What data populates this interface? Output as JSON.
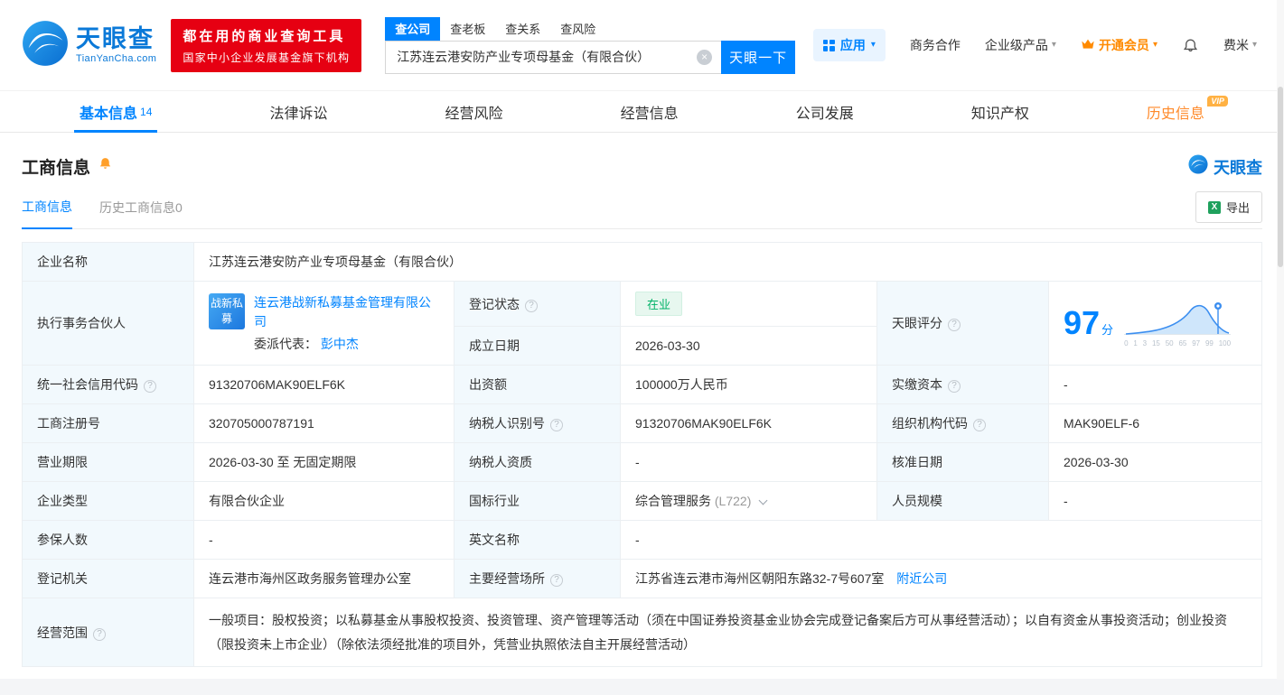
{
  "colors": {
    "brand_blue": "#0084ff",
    "banner_red": "#e60012",
    "vip_orange": "#ff8a00",
    "status_green": "#00b267"
  },
  "icons": {
    "clear": "×",
    "caret_down": "▾",
    "help": "?",
    "excel": "X"
  },
  "header": {
    "brand": {
      "name": "天眼查",
      "domain": "TianYanCha.com"
    },
    "slogan": {
      "line1": "都在用的商业查询工具",
      "line2": "国家中小企业发展基金旗下机构"
    },
    "search": {
      "tabs": [
        {
          "label": "查公司"
        },
        {
          "label": "查老板"
        },
        {
          "label": "查关系"
        },
        {
          "label": "查风险"
        }
      ],
      "value": "江苏连云港安防产业专项母基金（有限合伙）",
      "button": "天眼一下"
    },
    "menu": {
      "apps": "应用",
      "cooperation": "商务合作",
      "enterprise": "企业级产品",
      "vip": "开通会员",
      "user": "费米"
    }
  },
  "nav": {
    "vip_badge": "VIP",
    "tabs": [
      {
        "label": "基本信息",
        "count": "14"
      },
      {
        "label": "法律诉讼"
      },
      {
        "label": "经营风险"
      },
      {
        "label": "经营信息"
      },
      {
        "label": "公司发展"
      },
      {
        "label": "知识产权"
      },
      {
        "label": "历史信息"
      }
    ]
  },
  "section": {
    "title": "工商信息",
    "brand": "天眼查",
    "subtab_active": "工商信息",
    "subtab_history": "历史工商信息0",
    "export": "导出"
  },
  "biz": {
    "company_name": {
      "label": "企业名称",
      "value": "江苏连云港安防产业专项母基金（有限合伙）"
    },
    "partner": {
      "label": "执行事务合伙人",
      "badge": "战新私募",
      "company": "连云港战新私募基金管理有限公司",
      "delegate_label": "委派代表：",
      "delegate": "彭中杰"
    },
    "reg_status": {
      "label": "登记状态",
      "value": "在业"
    },
    "establish_date": {
      "label": "成立日期",
      "value": "2026-03-30"
    },
    "score": {
      "label": "天眼评分",
      "value": "97",
      "unit": "分",
      "ticks": [
        "0",
        "1",
        "3",
        "15",
        "50",
        "65",
        "97",
        "99",
        "100"
      ]
    },
    "credit_code": {
      "label": "统一社会信用代码",
      "value": "91320706MAK90ELF6K"
    },
    "capital": {
      "label": "出资额",
      "value": "100000万人民币"
    },
    "paid_capital": {
      "label": "实缴资本",
      "value": "-"
    },
    "reg_number": {
      "label": "工商注册号",
      "value": "320705000787191"
    },
    "taxpayer_id": {
      "label": "纳税人识别号",
      "value": "91320706MAK90ELF6K"
    },
    "org_code": {
      "label": "组织机构代码",
      "value": "MAK90ELF-6"
    },
    "business_term": {
      "label": "营业期限",
      "value": "2026-03-30 至 无固定期限"
    },
    "taxpayer_quality": {
      "label": "纳税人资质",
      "value": "-"
    },
    "approval_date": {
      "label": "核准日期",
      "value": "2026-03-30"
    },
    "company_type": {
      "label": "企业类型",
      "value": "有限合伙企业"
    },
    "industry": {
      "label": "国标行业",
      "value": "综合管理服务",
      "code": "(L722)"
    },
    "staff_size": {
      "label": "人员规模",
      "value": "-"
    },
    "insured_count": {
      "label": "参保人数",
      "value": "-"
    },
    "english_name": {
      "label": "英文名称",
      "value": "-"
    },
    "reg_authority": {
      "label": "登记机关",
      "value": "连云港市海州区政务服务管理办公室"
    },
    "business_place": {
      "label": "主要经营场所",
      "value": "江苏省连云港市海州区朝阳东路32-7号607室",
      "nearby": "附近公司"
    },
    "business_scope": {
      "label": "经营范围",
      "value": "一般项目：股权投资；以私募基金从事股权投资、投资管理、资产管理等活动（须在中国证券投资基金业协会完成登记备案后方可从事经营活动）；以自有资金从事投资活动；创业投资（限投资未上市企业）（除依法须经批准的项目外，凭营业执照依法自主开展经营活动）"
    }
  }
}
